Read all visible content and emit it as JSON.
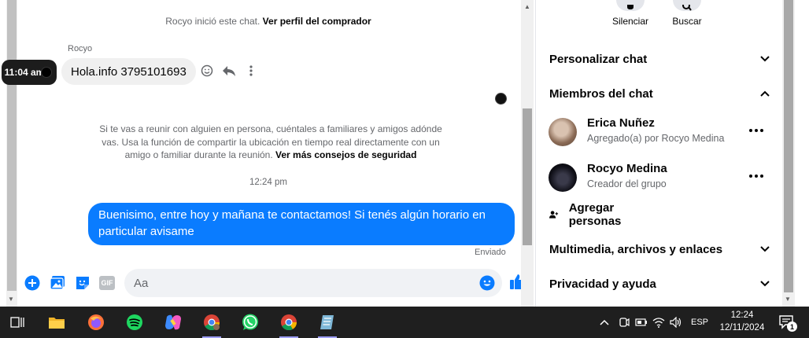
{
  "chat": {
    "system_message": "Rocyo inició este chat.",
    "system_link": "Ver perfil del comprador",
    "sender_name": "Rocyo",
    "hover_time": "11:04 am",
    "incoming_message": "Hola.info 3795101693",
    "safety_text": "Si te vas a reunir con alguien en persona, cuéntales a familiares y amigos adónde vas. Usa la función de compartir la ubicación en tiempo real directamente con un amigo o familiar durante la reunión.",
    "safety_link": "Ver más consejos de seguridad",
    "timestamp": "12:24 pm",
    "outgoing_message": "Buenisimo, entre hoy y mañana te contactamos! Si tenés algún horario en particular avisame",
    "sent_status": "Enviado",
    "composer_placeholder": "Aa",
    "composer_gif": "GIF"
  },
  "panel": {
    "mute_label": "Silenciar",
    "search_label": "Buscar",
    "customize_chat": "Personalizar chat",
    "chat_members": "Miembros del chat",
    "members": [
      {
        "name": "Erica Nuñez",
        "subtitle": "Agregado(a) por Rocyo Medina"
      },
      {
        "name": "Rocyo Medina",
        "subtitle": "Creador del grupo"
      }
    ],
    "add_people": "Agregar personas",
    "media_files_links": "Multimedia, archivos y enlaces",
    "privacy_help": "Privacidad y ayuda"
  },
  "taskbar": {
    "language": "ESP",
    "time": "12:24",
    "date": "12/11/2024",
    "notification_count": "1"
  },
  "colors": {
    "accent": "#0a7cff",
    "taskbar_bg": "#1f1f1f",
    "bubble_in": "#f0f0f0"
  }
}
